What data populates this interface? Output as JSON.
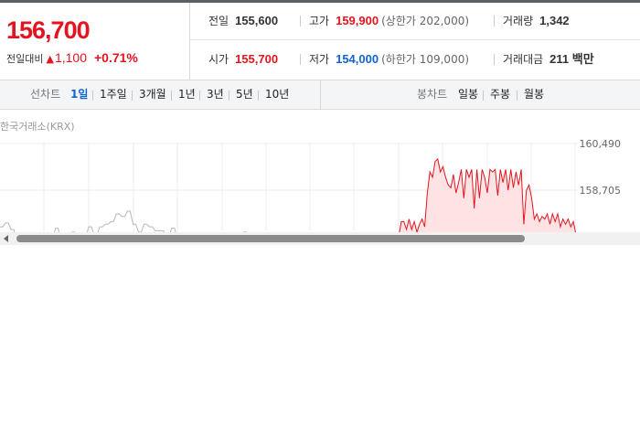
{
  "price": {
    "current": "156,700",
    "change_label": "전일대비",
    "change_arrow": "▲",
    "change_value": "1,100",
    "change_percent": "+0.71%"
  },
  "info": {
    "prev_close": {
      "label": "전일",
      "value": "155,600"
    },
    "high": {
      "label": "고가",
      "value": "159,900",
      "limit": "(상한가 202,000)"
    },
    "volume": {
      "label": "거래량",
      "value": "1,342"
    },
    "open": {
      "label": "시가",
      "value": "155,700"
    },
    "low": {
      "label": "저가",
      "value": "154,000",
      "limit": "(하한가 109,000)"
    },
    "turnover": {
      "label": "거래대금",
      "value": "211 백만"
    }
  },
  "toolbar": {
    "line_label": "선차트",
    "line_items": [
      "1일",
      "1주일",
      "3개월",
      "1년",
      "3년",
      "5년",
      "10년"
    ],
    "active_line_item": "1일",
    "candle_label": "봉차트",
    "candle_items": [
      "일봉",
      "주봉",
      "월봉"
    ]
  },
  "chart": {
    "source": "한국거래소(KRX)",
    "colors": {
      "up": "#e4141e",
      "flat": "#b8b8b8",
      "fill": "#fde3e3"
    }
  },
  "chart_data": {
    "type": "line",
    "title": "",
    "y_tick_labels": [
      "160,490",
      "158,705"
    ],
    "ylim": [
      156920,
      160490
    ],
    "grid": true,
    "series": [
      {
        "color": "#b8b8b8",
        "values": [
          157300,
          157300,
          157450,
          157450,
          157200,
          157200,
          156700,
          156700,
          156880,
          156880,
          156700,
          156700,
          156700,
          156700,
          156700,
          156700,
          156600,
          156600,
          156700,
          156700,
          157250,
          157250,
          156700,
          156700,
          156700,
          156700,
          157100,
          157100,
          156880,
          156880,
          156900,
          156900,
          157300,
          157300,
          157000,
          157000,
          157300,
          157300,
          157400,
          157400,
          157500,
          157500,
          157800,
          157800,
          157700,
          157700,
          157900,
          157900,
          157400,
          157400,
          157100,
          157100,
          157400,
          157400,
          157300,
          157300,
          157150,
          157150,
          157150,
          157150,
          156950,
          156950,
          157250,
          157250,
          156850,
          156850,
          156900,
          156900,
          156900,
          156900,
          156900,
          156900,
          156800,
          156800,
          156800,
          156800,
          156800,
          156800,
          156800,
          156800,
          156800,
          156800,
          156800,
          156800,
          156800,
          156800,
          156800,
          156800,
          157100,
          157100,
          156950,
          156950,
          157050,
          157050,
          156950,
          156950,
          156750,
          156750,
          156750,
          156750
        ]
      },
      {
        "color": "#e4141e",
        "values": [
          156900,
          157500,
          157500,
          157200,
          157600,
          157200,
          157500,
          157100,
          157400,
          157600,
          157300,
          158600,
          159400,
          159200,
          159800,
          159900,
          159400,
          159600,
          159200,
          158900,
          158800,
          159300,
          158600,
          159000,
          159500,
          158400,
          159500,
          159200,
          159500,
          158000,
          159500,
          158400,
          159500,
          159200,
          158600,
          159500,
          159400,
          159500,
          158500,
          159500,
          159000,
          159500,
          158700,
          159500,
          158800,
          159400,
          158900,
          159500,
          157400,
          158700,
          158900,
          158400,
          157600,
          157800,
          157500,
          157700,
          157600,
          157800,
          157400,
          157800,
          157500,
          157800,
          157300,
          157600,
          157400,
          157600,
          157300,
          157500,
          157000
        ]
      }
    ]
  }
}
